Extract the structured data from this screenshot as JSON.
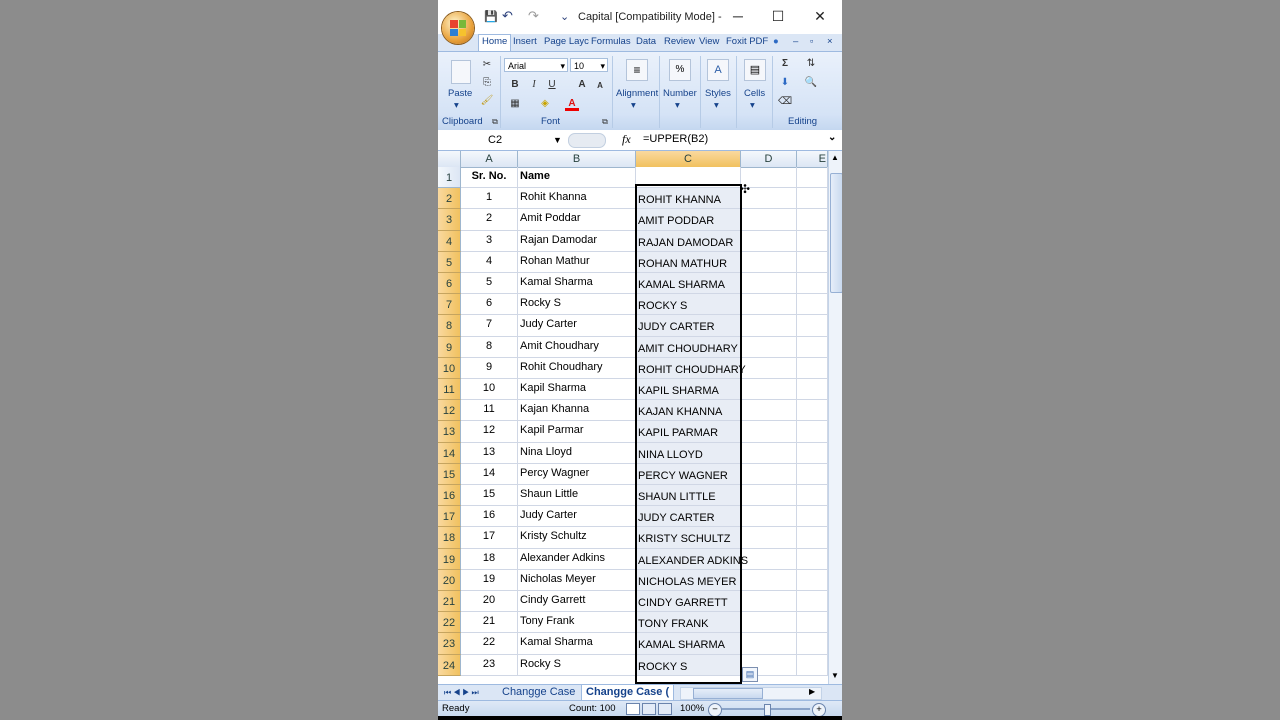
{
  "window": {
    "title": "Capital  [Compatibility Mode] -",
    "controls": {
      "minimize": "─",
      "maximize": "☐",
      "close": "✕"
    }
  },
  "quick_access": {
    "save": "💾",
    "undo": "↶",
    "redo": "↷",
    "more": "⌄"
  },
  "tabs": [
    "Home",
    "Insert",
    "Page Layc",
    "Formulas",
    "Data",
    "Review",
    "View",
    "Foxit PDF"
  ],
  "ribbon": {
    "clipboard": {
      "paste": "Paste",
      "label": "Clipboard"
    },
    "font": {
      "name": "Arial",
      "size": "10",
      "bold": "B",
      "italic": "I",
      "underline": "U",
      "label": "Font",
      "grow": "A",
      "shrink": "A"
    },
    "alignment": {
      "label": "Alignment"
    },
    "number": {
      "label": "Number",
      "icon": "%"
    },
    "styles": {
      "label": "Styles"
    },
    "cells": {
      "label": "Cells"
    },
    "editing": {
      "label": "Editing",
      "sigma": "Σ"
    }
  },
  "formula_bar": {
    "name_box": "C2",
    "fx": "fx",
    "formula": "=UPPER(B2)"
  },
  "columns": [
    "A",
    "B",
    "C",
    "D",
    "E"
  ],
  "header_row": {
    "row": "1",
    "a": "Sr. No.",
    "b": "Name",
    "c": ""
  },
  "rows": [
    {
      "row": "2",
      "a": "1",
      "b": "Rohit Khanna",
      "c": "ROHIT KHANNA"
    },
    {
      "row": "3",
      "a": "2",
      "b": "Amit Poddar",
      "c": "AMIT PODDAR"
    },
    {
      "row": "4",
      "a": "3",
      "b": "Rajan Damodar",
      "c": "RAJAN DAMODAR"
    },
    {
      "row": "5",
      "a": "4",
      "b": "Rohan Mathur",
      "c": "ROHAN MATHUR"
    },
    {
      "row": "6",
      "a": "5",
      "b": "Kamal Sharma",
      "c": "KAMAL SHARMA"
    },
    {
      "row": "7",
      "a": "6",
      "b": "Rocky S",
      "c": "ROCKY S"
    },
    {
      "row": "8",
      "a": "7",
      "b": "Judy Carter",
      "c": "JUDY CARTER"
    },
    {
      "row": "9",
      "a": "8",
      "b": "Amit Choudhary",
      "c": "AMIT CHOUDHARY"
    },
    {
      "row": "10",
      "a": "9",
      "b": "Rohit Choudhary",
      "c": "ROHIT CHOUDHARY"
    },
    {
      "row": "11",
      "a": "10",
      "b": "Kapil Sharma",
      "c": "KAPIL SHARMA"
    },
    {
      "row": "12",
      "a": "11",
      "b": "Kajan Khanna",
      "c": "KAJAN KHANNA"
    },
    {
      "row": "13",
      "a": "12",
      "b": "Kapil Parmar",
      "c": "KAPIL PARMAR"
    },
    {
      "row": "14",
      "a": "13",
      "b": "Nina Lloyd",
      "c": "NINA LLOYD"
    },
    {
      "row": "15",
      "a": "14",
      "b": "Percy Wagner",
      "c": "PERCY WAGNER"
    },
    {
      "row": "16",
      "a": "15",
      "b": "Shaun Little",
      "c": "SHAUN LITTLE"
    },
    {
      "row": "17",
      "a": "16",
      "b": "Judy Carter",
      "c": "JUDY CARTER"
    },
    {
      "row": "18",
      "a": "17",
      "b": "Kristy Schultz",
      "c": "KRISTY SCHULTZ"
    },
    {
      "row": "19",
      "a": "18",
      "b": "Alexander Adkins",
      "c": "ALEXANDER ADKINS"
    },
    {
      "row": "20",
      "a": "19",
      "b": "Nicholas Meyer",
      "c": "NICHOLAS MEYER"
    },
    {
      "row": "21",
      "a": "20",
      "b": "Cindy Garrett",
      "c": "CINDY GARRETT"
    },
    {
      "row": "22",
      "a": "21",
      "b": "Tony Frank",
      "c": "TONY FRANK"
    },
    {
      "row": "23",
      "a": "22",
      "b": "Kamal Sharma",
      "c": "KAMAL SHARMA"
    },
    {
      "row": "24",
      "a": "23",
      "b": "Rocky S",
      "c": "ROCKY S"
    }
  ],
  "sheet_tabs": {
    "tab1": "Changge  Case",
    "tab2": "Changge  Case ("
  },
  "status": {
    "ready": "Ready",
    "count": "Count: 100",
    "zoom": "100%"
  }
}
